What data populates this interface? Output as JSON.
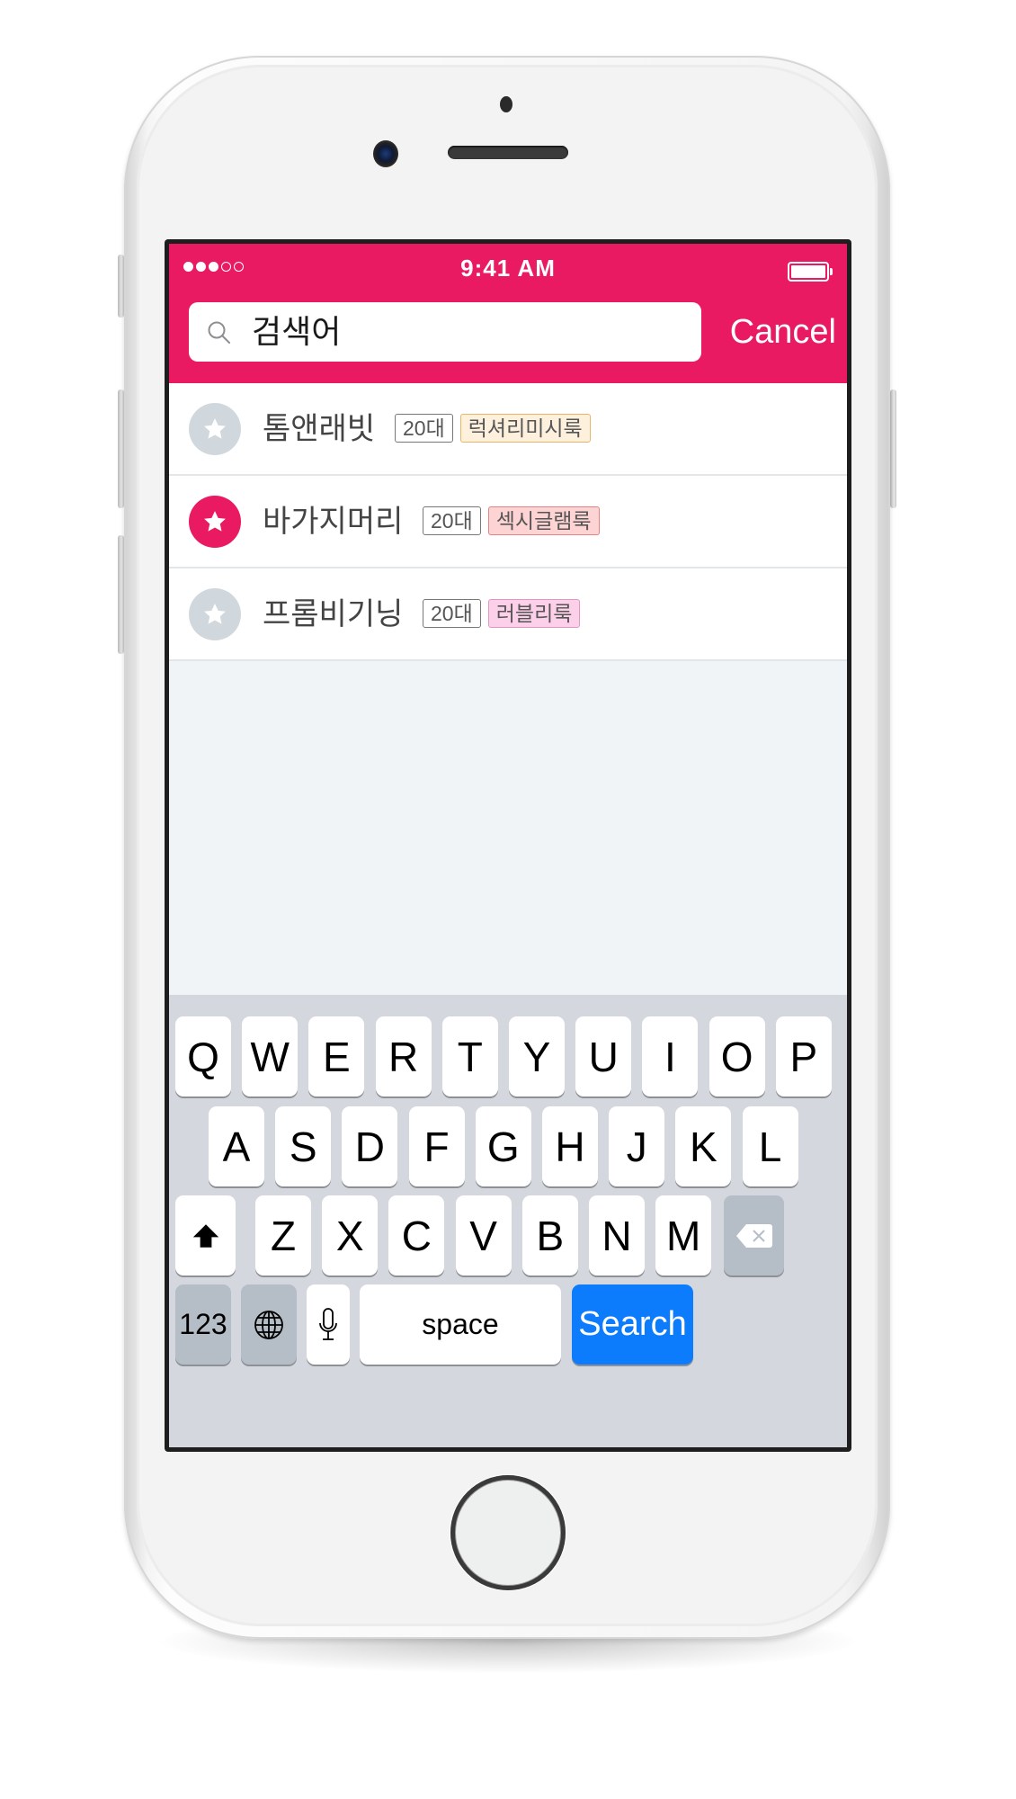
{
  "device": {
    "model": "white smartphone mockup"
  },
  "status_bar": {
    "signal_dots_filled": 3,
    "signal_dots_total": 5,
    "time": "9:41 AM",
    "battery_level": 1.0
  },
  "search": {
    "value": "검색어",
    "icon": "search-icon",
    "cancel_label": "Cancel"
  },
  "colors": {
    "accent": "#e91a62",
    "star_inactive": "#d0d8de",
    "keyboard_bg": "#d4d8de",
    "search_key": "#0c7bfc"
  },
  "results": [
    {
      "name": "톰앤래빗",
      "favorite": false,
      "age_tag": "20대",
      "style_tag": "럭셔리미시룩",
      "style_color": {
        "bg": "#fdf0dc",
        "border": "#e7b667"
      }
    },
    {
      "name": "바가지머리",
      "favorite": true,
      "age_tag": "20대",
      "style_tag": "섹시글램룩",
      "style_color": {
        "bg": "#fdd3d3",
        "border": "#e88080"
      }
    },
    {
      "name": "프롬비기닝",
      "favorite": false,
      "age_tag": "20대",
      "style_tag": "러블리룩",
      "style_color": {
        "bg": "#fdd0ea",
        "border": "#e495c4"
      }
    }
  ],
  "keyboard": {
    "row1": [
      "Q",
      "W",
      "E",
      "R",
      "T",
      "Y",
      "U",
      "I",
      "O",
      "P"
    ],
    "row2": [
      "A",
      "S",
      "D",
      "F",
      "G",
      "H",
      "J",
      "K",
      "L"
    ],
    "row3": [
      "Z",
      "X",
      "C",
      "V",
      "B",
      "N",
      "M"
    ],
    "shift_icon": "shift-arrow-icon",
    "delete_icon": "backspace-icon",
    "numbers_label": "123",
    "globe_icon": "globe-icon",
    "mic_icon": "microphone-icon",
    "space_label": "space",
    "search_label": "Search"
  }
}
